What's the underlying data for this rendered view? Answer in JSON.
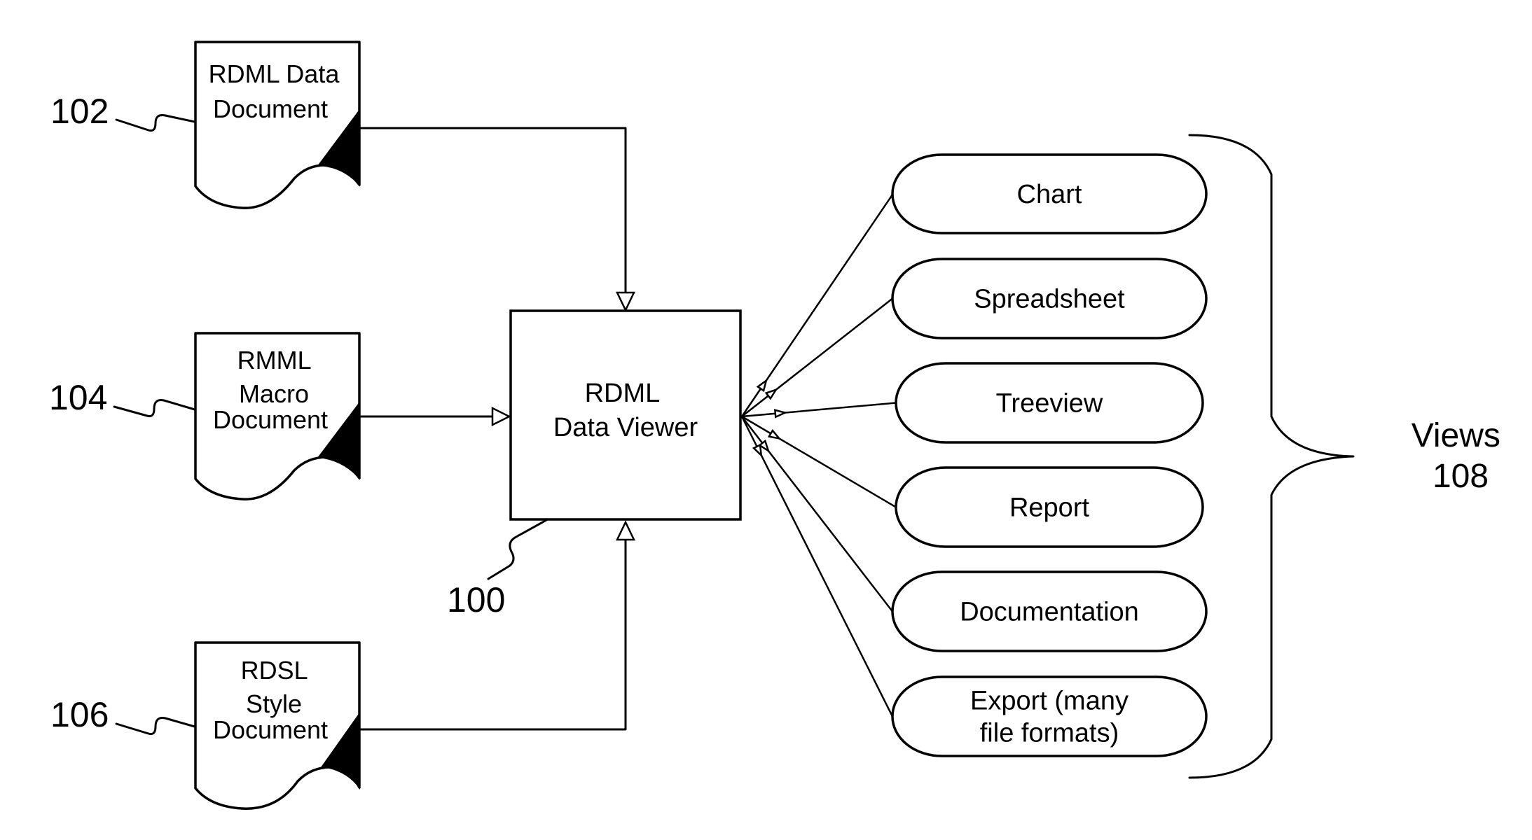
{
  "diagram": {
    "documents": [
      {
        "id": "102",
        "ref_label": "102",
        "lines": [
          "RDML Data",
          "Document"
        ]
      },
      {
        "id": "104",
        "ref_label": "104",
        "lines": [
          "RMML",
          "Macro",
          "Document"
        ]
      },
      {
        "id": "106",
        "ref_label": "106",
        "lines": [
          "RDSL",
          "Style",
          "Document"
        ]
      }
    ],
    "viewer": {
      "ref_label": "100",
      "lines": [
        "RDML",
        "Data Viewer"
      ]
    },
    "views": [
      {
        "lines": [
          "Chart"
        ]
      },
      {
        "lines": [
          "Spreadsheet"
        ]
      },
      {
        "lines": [
          "Treeview"
        ]
      },
      {
        "lines": [
          "Report"
        ]
      },
      {
        "lines": [
          "Documentation"
        ]
      },
      {
        "lines": [
          "Export (many",
          "file formats)"
        ]
      }
    ],
    "views_group": {
      "title": "Views",
      "ref_label": "108"
    },
    "edges": [
      {
        "from": "102",
        "to": "viewer"
      },
      {
        "from": "104",
        "to": "viewer"
      },
      {
        "from": "106",
        "to": "viewer"
      },
      {
        "from": "viewer",
        "to": "Chart"
      },
      {
        "from": "viewer",
        "to": "Spreadsheet"
      },
      {
        "from": "viewer",
        "to": "Treeview"
      },
      {
        "from": "viewer",
        "to": "Report"
      },
      {
        "from": "viewer",
        "to": "Documentation"
      },
      {
        "from": "viewer",
        "to": "Export (many file formats)"
      }
    ]
  }
}
